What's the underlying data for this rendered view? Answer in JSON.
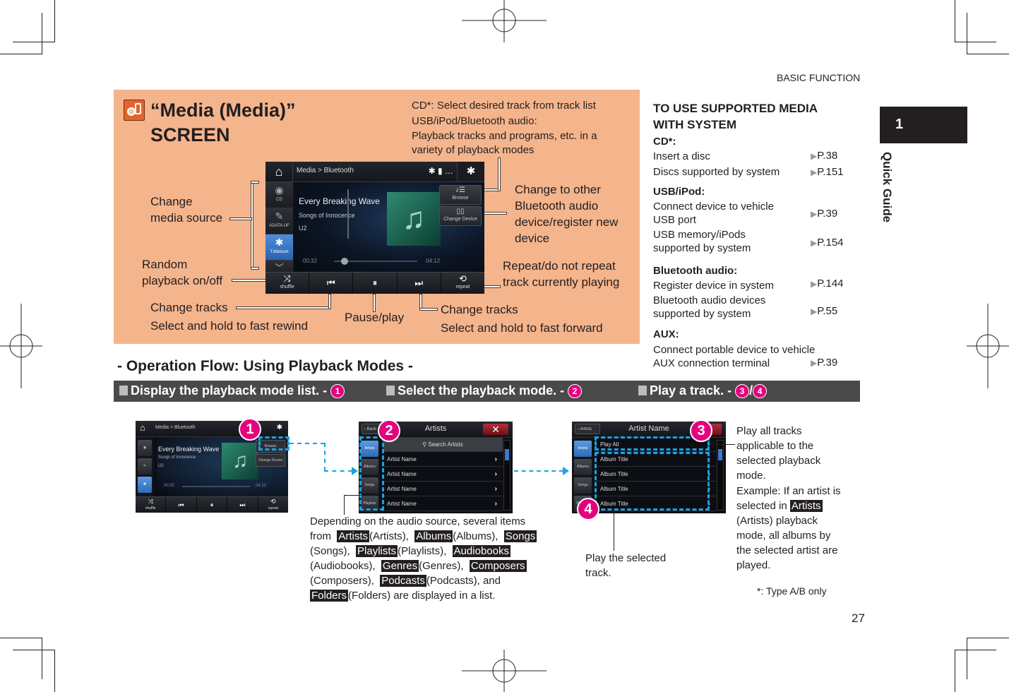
{
  "header": {
    "section": "BASIC FUNCTION",
    "chapter_number": "1",
    "chapter_label": "Quick Guide",
    "page_number": "27"
  },
  "media_panel": {
    "icon": "media-app-icon",
    "title_line1": "“Media (Media)”",
    "title_line2": "SCREEN",
    "description": [
      "CD*: Select desired track from track list",
      "USB/iPod/Bluetooth audio:",
      "Playback tracks and programs, etc. in a",
      "variety of playback modes"
    ],
    "callouts": {
      "change_source": [
        "Change",
        "media source"
      ],
      "random": [
        "Random",
        "playback on/off"
      ],
      "change_tracks_back": [
        "Change tracks",
        "Select and hold to fast rewind"
      ],
      "pause_play": "Pause/play",
      "change_tracks_fwd": [
        "Change tracks",
        "Select and hold to fast forward"
      ],
      "change_device": [
        "Change to other",
        "Bluetooth audio",
        "device/register new",
        "device"
      ],
      "repeat": [
        "Repeat/do not repeat",
        "track currently playing"
      ]
    },
    "screen": {
      "breadcrumb": "Media > Bluetooth",
      "sources": [
        {
          "label": "CD",
          "icon": "disc-icon"
        },
        {
          "label": "ADATA UF",
          "icon": "usb-icon"
        },
        {
          "label": "T.Matsum",
          "icon": "bluetooth-icon"
        }
      ],
      "track_title": "Every Breaking Wave",
      "album": "Songs of Innocence",
      "artist": "U2",
      "elapsed": "00:32",
      "duration": "04:12",
      "progress": 0.13,
      "browse_label": "Browse",
      "change_device_label": "Change Device",
      "controls": {
        "shuffle": "shuffle",
        "repeat": "repeat"
      }
    }
  },
  "supported_media": {
    "title_line1": "TO USE SUPPORTED MEDIA",
    "title_line2": "WITH SYSTEM",
    "sections": [
      {
        "heading": "CD*:",
        "items": [
          {
            "text": [
              "Insert a disc"
            ],
            "ref": "P.38"
          },
          {
            "text": [
              "Discs supported by system"
            ],
            "ref": "P.151"
          }
        ]
      },
      {
        "heading": "USB/iPod:",
        "items": [
          {
            "text": [
              "Connect device to vehicle",
              "USB port"
            ],
            "ref": "P.39"
          },
          {
            "text": [
              "USB memory/iPods",
              "supported by system"
            ],
            "ref": "P.154"
          }
        ]
      },
      {
        "heading": "Bluetooth audio:",
        "items": [
          {
            "text": [
              "Register device in system"
            ],
            "ref": "P.144"
          },
          {
            "text": [
              "Bluetooth audio devices",
              "supported by system"
            ],
            "ref": "P.55"
          }
        ]
      },
      {
        "heading": "AUX:",
        "items": [
          {
            "text": [
              "Connect portable device to vehicle",
              "AUX connection terminal"
            ],
            "ref": "P.39"
          }
        ]
      }
    ]
  },
  "flow": {
    "title": "- Operation Flow: Using Playback Modes -",
    "steps": [
      {
        "label": "Display the playback mode list. -",
        "nums": [
          "1"
        ]
      },
      {
        "label": "Select the playback mode. -",
        "nums": [
          "2"
        ]
      },
      {
        "label": "Play a track. -",
        "nums": [
          "3",
          "4"
        ],
        "sep": "/"
      }
    ],
    "screen1": {
      "breadcrumb": "Media > Bluetooth",
      "track_title": "Every Breaking Wave",
      "album": "Songs of Innocence",
      "artist": "U2",
      "elapsed": "00:32",
      "duration": "04:12",
      "browse": "Browse",
      "change_device": "Change Device",
      "shuffle": "shuffle",
      "repeat": "repeat",
      "badge": "1"
    },
    "screen2": {
      "title": "Artists",
      "back": "Back",
      "search": "Search Artists",
      "tabs": [
        "Artists",
        "Albums",
        "Songs",
        "Playlists"
      ],
      "rows": [
        "Artist Name",
        "Artist Name",
        "Artist Name",
        "Artist Name"
      ],
      "badge": "2"
    },
    "screen3": {
      "title": "Artist Name",
      "back": "Artists",
      "play_all": "Play All",
      "tabs": [
        "Artists",
        "Albums",
        "Songs",
        "Playlists"
      ],
      "rows": [
        "Album Title",
        "Album Title",
        "Album Title",
        "Album Title"
      ],
      "badge3": "3",
      "badge4": "4"
    },
    "modes_text": {
      "intro": "Depending on the audio source, several items",
      "from": "from",
      "items": [
        "Artists",
        "Albums",
        "Songs",
        "Playlists",
        "Audiobooks",
        "Genres",
        "Composers",
        "Podcasts",
        "Folders"
      ],
      "outro": "are displayed in a list."
    },
    "play_selected": [
      "Play the selected",
      "track."
    ],
    "play_all_desc": [
      "Play all tracks",
      "applicable to the",
      "selected playback",
      "mode."
    ],
    "example": {
      "pre": [
        "Example: If an artist is",
        "selected in"
      ],
      "tag": "Artists",
      "post": [
        "(Artists) playback",
        "mode, all albums by",
        "the selected artist are",
        "played."
      ]
    },
    "footnote": "*: Type A/B only"
  }
}
